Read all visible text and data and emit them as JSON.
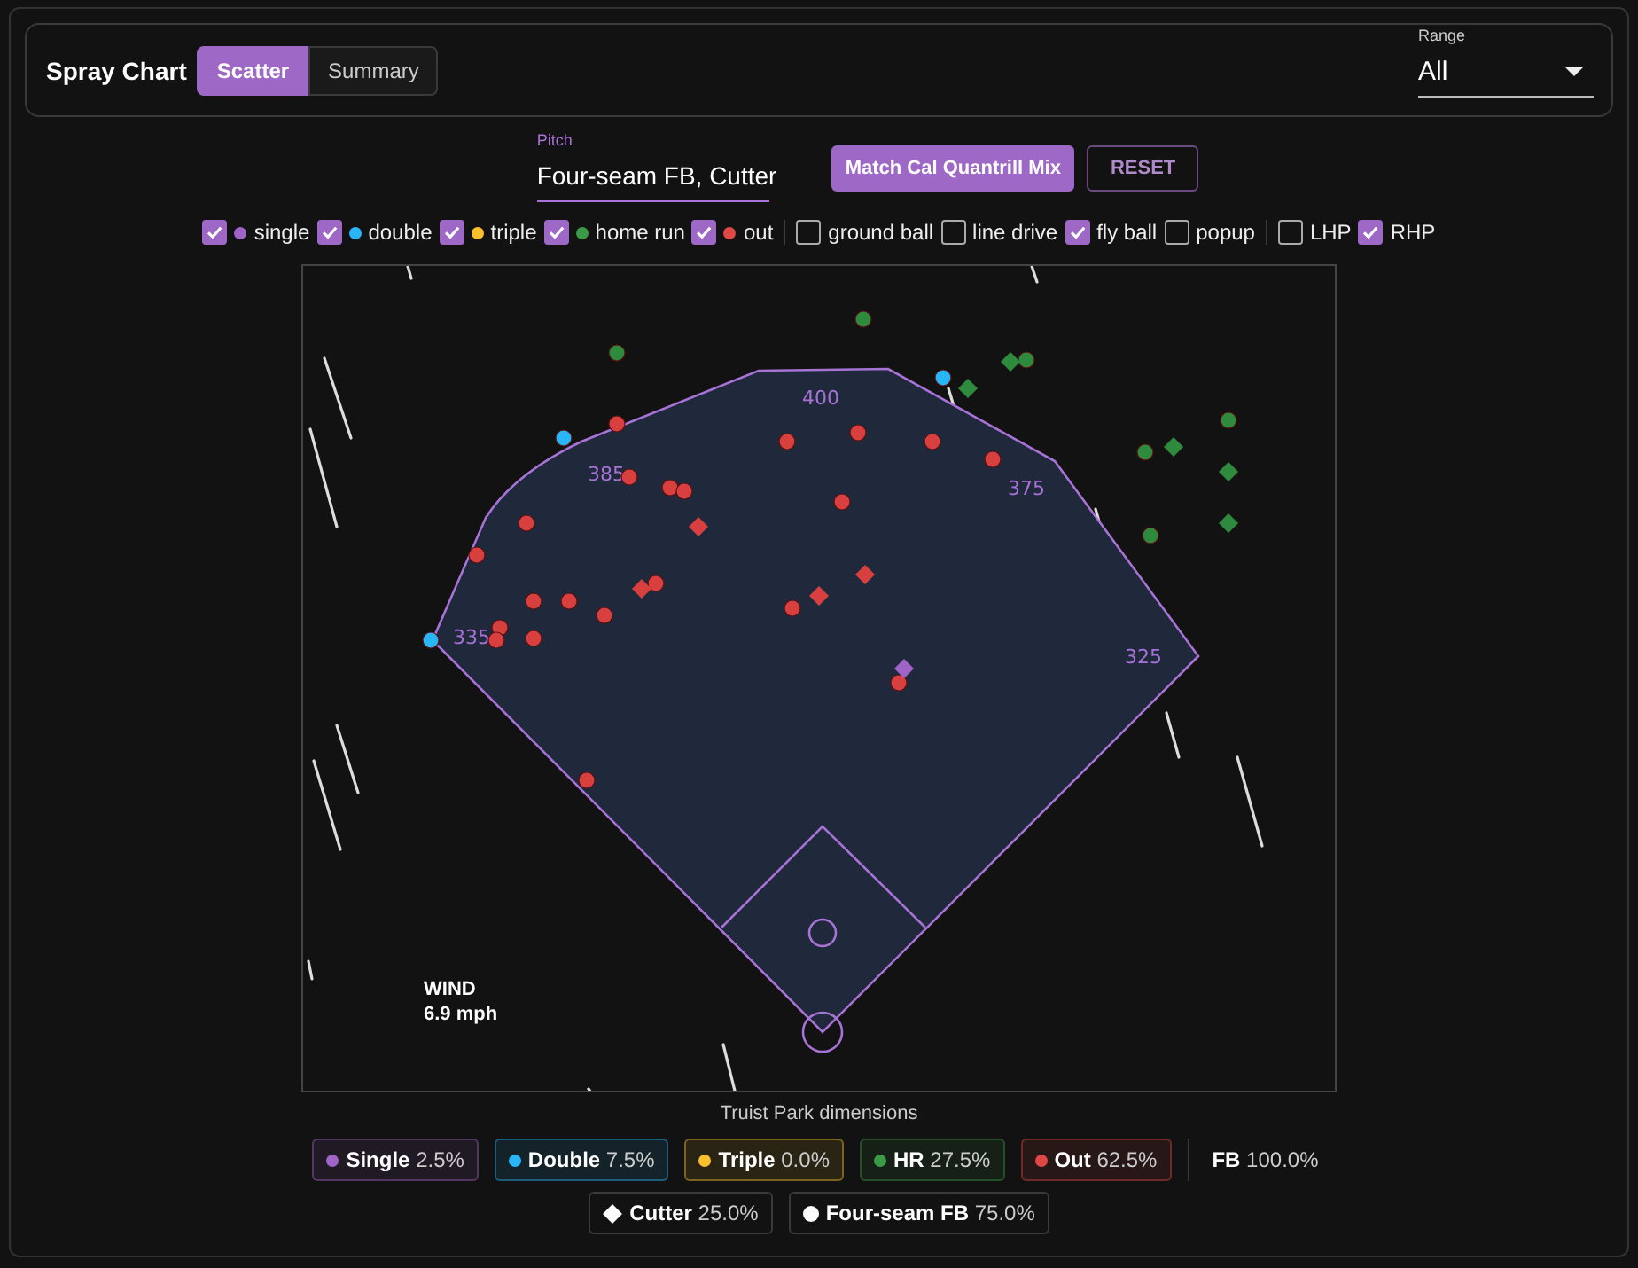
{
  "header": {
    "title": "Spray Chart",
    "view_tabs": [
      {
        "label": "Scatter",
        "selected": true
      },
      {
        "label": "Summary",
        "selected": false
      }
    ],
    "range": {
      "label": "Range",
      "value": "All"
    }
  },
  "pitch": {
    "label": "Pitch",
    "value": "Four-seam FB, Cutter"
  },
  "buttons": [
    {
      "label": "Match Cal Quantrill Mix",
      "kind": "primary"
    },
    {
      "label": "RESET",
      "kind": "outline"
    }
  ],
  "filter_groups": [
    [
      {
        "label": "single",
        "checked": true,
        "color": "#a064c8"
      },
      {
        "label": "double",
        "checked": true,
        "color": "#29b6f6"
      },
      {
        "label": "triple",
        "checked": true,
        "color": "#fbc02d"
      },
      {
        "label": "home run",
        "checked": true,
        "color": "#3a9a48"
      },
      {
        "label": "out",
        "checked": true,
        "color": "#e04848"
      }
    ],
    [
      {
        "label": "ground ball",
        "checked": false
      },
      {
        "label": "line drive",
        "checked": false
      },
      {
        "label": "fly ball",
        "checked": true
      },
      {
        "label": "popup",
        "checked": false
      }
    ],
    [
      {
        "label": "LHP",
        "checked": false
      },
      {
        "label": "RHP",
        "checked": true
      }
    ]
  ],
  "chart": {
    "distances": [
      "400",
      "385",
      "375",
      "335",
      "325"
    ],
    "wind": {
      "label": "WIND",
      "value": "6.9 mph"
    }
  },
  "caption": "Truist Park dimensions",
  "legend": {
    "results": [
      {
        "label": "Single",
        "value": "2.5%",
        "color": "#a064c8"
      },
      {
        "label": "Double",
        "value": "7.5%",
        "color": "#29b6f6"
      },
      {
        "label": "Triple",
        "value": "0.0%",
        "color": "#fbc02d"
      },
      {
        "label": "HR",
        "value": "27.5%",
        "color": "#3a9a48"
      },
      {
        "label": "Out",
        "value": "62.5%",
        "color": "#e04848"
      }
    ],
    "batted": {
      "label": "FB",
      "value": "100.0%"
    },
    "pitches": [
      {
        "label": "Cutter",
        "value": "25.0%",
        "kind": "diamond"
      },
      {
        "label": "Four-seam FB",
        "value": "75.0%",
        "kind": "circle"
      }
    ]
  }
}
